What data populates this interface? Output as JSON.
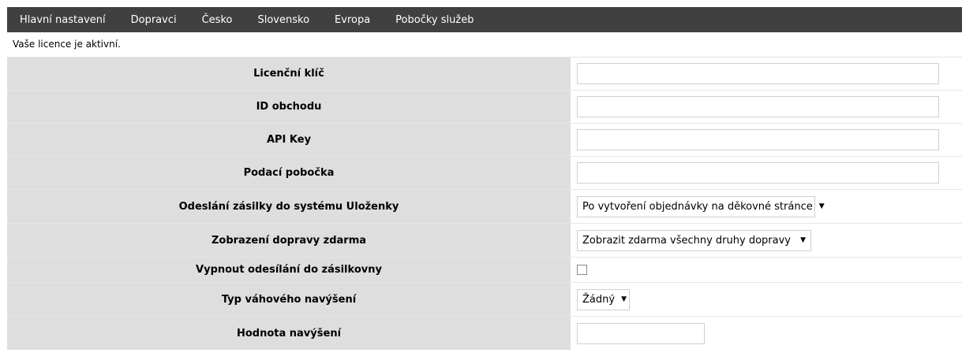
{
  "tabs": [
    {
      "label": "Hlavní nastavení"
    },
    {
      "label": "Dopravci"
    },
    {
      "label": "Česko"
    },
    {
      "label": "Slovensko"
    },
    {
      "label": "Evropa"
    },
    {
      "label": "Pobočky služeb"
    }
  ],
  "notice": "Vaše licence je aktivní.",
  "form": {
    "license_key": {
      "label": "Licenční klíč",
      "value": ""
    },
    "shop_id": {
      "label": "ID obchodu",
      "value": ""
    },
    "api_key": {
      "label": "API Key",
      "value": ""
    },
    "branch": {
      "label": "Podací pobočka",
      "value": ""
    },
    "send_shipment": {
      "label": "Odeslání zásilky do systému Uloženky",
      "selected": "Po vytvoření objednávky na děkovné stránce"
    },
    "free_shipping": {
      "label": "Zobrazení dopravy zdarma",
      "selected": "Zobrazit zdarma všechny druhy dopravy"
    },
    "disable_sending": {
      "label": "Vypnout odesílání do zásilkovny",
      "checked": false
    },
    "weight_increase_type": {
      "label": "Typ váhového navýšení",
      "selected": "Žádný"
    },
    "increase_value": {
      "label": "Hodnota navýšení",
      "value": ""
    }
  },
  "icons": {
    "dropdown": "caret-down-icon"
  }
}
